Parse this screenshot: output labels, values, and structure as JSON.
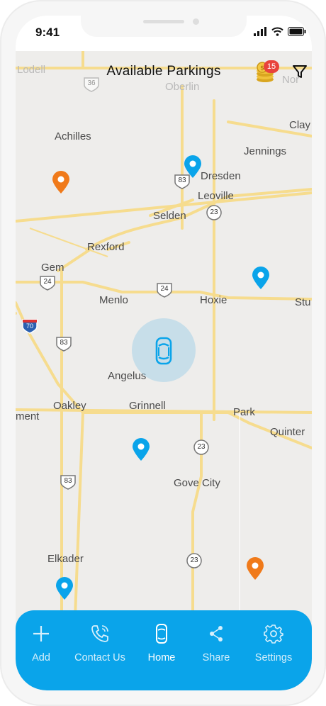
{
  "status": {
    "time": "9:41"
  },
  "header": {
    "title": "Available Parkings",
    "coin_count": "15"
  },
  "map": {
    "towns": {
      "lodell": "Lodell",
      "oberlin": "Oberlin",
      "norcatur": "Nor",
      "achilles": "Achilles",
      "clay": "Clay",
      "jennings": "Jennings",
      "dresden": "Dresden",
      "leoville": "Leoville",
      "selden": "Selden",
      "rexford": "Rexford",
      "gem": "Gem",
      "menlo": "Menlo",
      "hoxie": "Hoxie",
      "studley": "Stu",
      "angelus": "Angelus",
      "oakley": "Oakley",
      "grinnell": "Grinnell",
      "park": "Park",
      "quinter": "Quinter",
      "monument": "ment",
      "gove_city": "Gove City",
      "elkader": "Elkader"
    },
    "routes": {
      "r36": "36",
      "r83a": "83",
      "r23a": "23",
      "r24a": "24",
      "r24b": "24",
      "i70": "70",
      "r83b": "83",
      "r23b": "23",
      "r83c": "83",
      "r23c": "23"
    }
  },
  "tabs": [
    {
      "label": "Add",
      "icon": "plus-icon"
    },
    {
      "label": "Contact Us",
      "icon": "phone-icon"
    },
    {
      "label": "Home",
      "icon": "car-icon",
      "active": true
    },
    {
      "label": "Share",
      "icon": "share-icon"
    },
    {
      "label": "Settings",
      "icon": "gear-icon"
    }
  ],
  "colors": {
    "accent": "#0aa4ea",
    "pin_blue": "#0aa4ea",
    "pin_orange": "#f07a1a",
    "road": "#f6dc8e"
  }
}
